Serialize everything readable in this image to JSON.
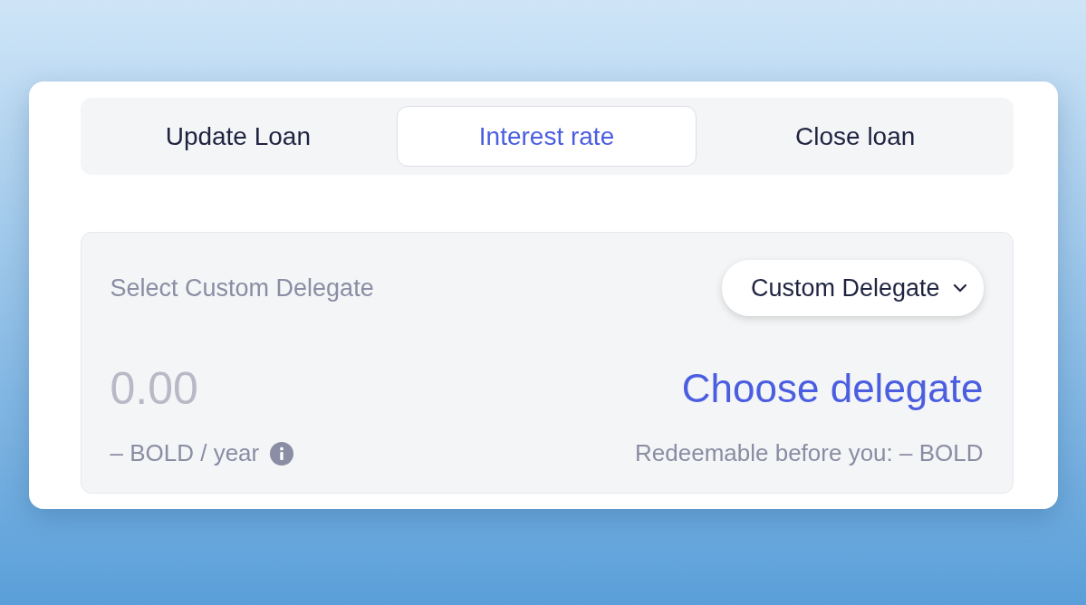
{
  "tabs": [
    {
      "label": "Update Loan",
      "selected": false
    },
    {
      "label": "Interest rate",
      "selected": true
    },
    {
      "label": "Close loan",
      "selected": false
    }
  ],
  "delegate_panel": {
    "label": "Select Custom Delegate",
    "dropdown": "Custom Delegate",
    "amount": {
      "placeholder": "0.00"
    },
    "action": "Choose delegate",
    "rate_note": "– BOLD / year",
    "redeemable": "Redeemable before you: – BOLD"
  }
}
